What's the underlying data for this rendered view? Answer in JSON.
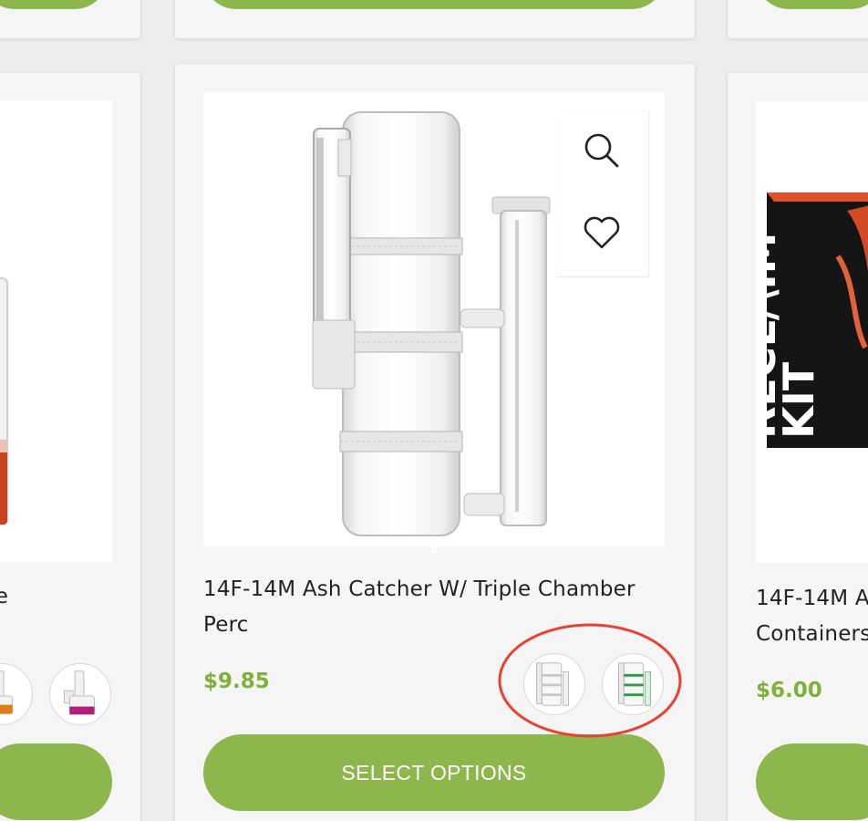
{
  "products": {
    "left": {
      "title_fragment": "ne",
      "button_label": ""
    },
    "center": {
      "title_line1": "14F-14M Ash Catcher W/ Triple Chamber",
      "title_line2": "Perc",
      "price": "$9.85",
      "button_label": "SELECT OPTIONS",
      "swatches": [
        {
          "name": "clear"
        },
        {
          "name": "green"
        }
      ],
      "quick_actions": {
        "zoom_icon": "magnifier-icon",
        "wishlist_icon": "heart-icon"
      }
    },
    "right": {
      "title_line1": "14F-14M A",
      "title_line2": "Containers",
      "price": "$6.00",
      "box_text_line1": "RECL/\\IM",
      "box_text_line2": "KIT"
    }
  },
  "colors": {
    "accent": "#8db64c",
    "price": "#80b03c",
    "annotation": "#e8412f"
  }
}
